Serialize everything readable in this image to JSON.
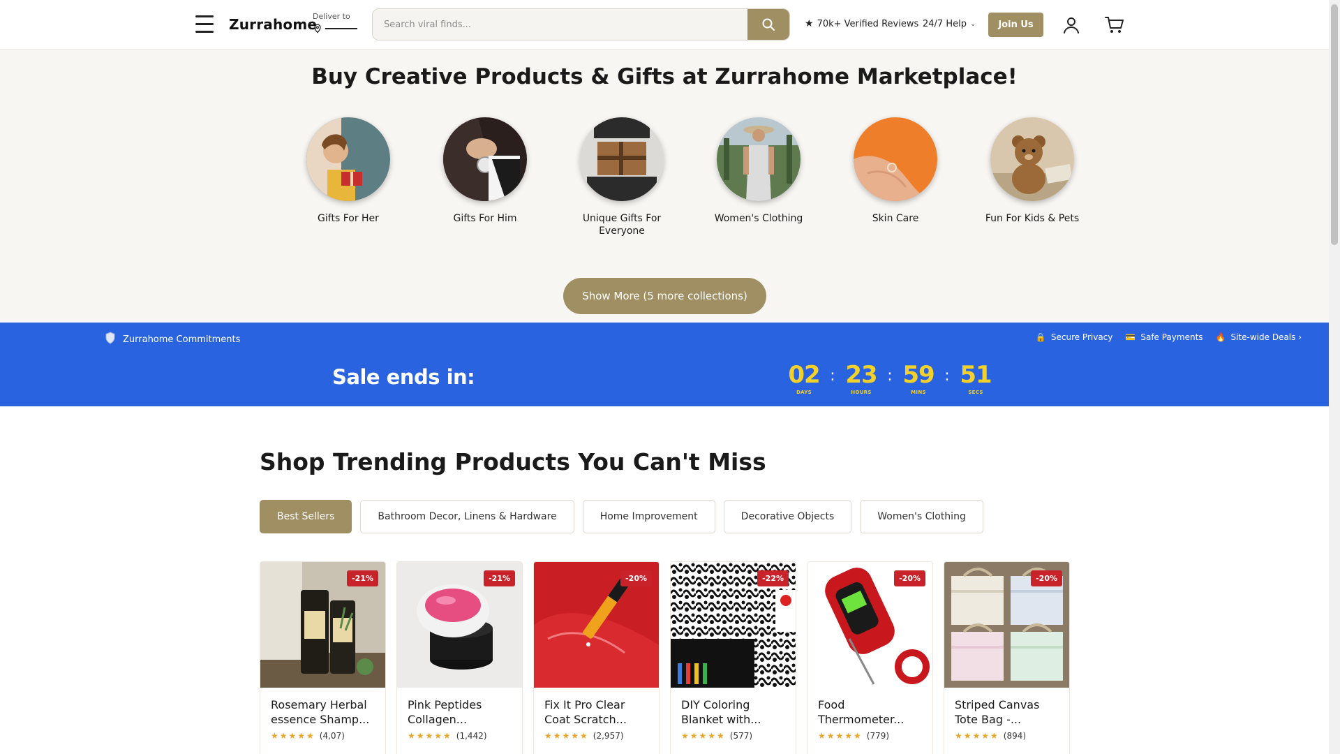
{
  "header": {
    "logo": "Zurrahome",
    "deliver_label": "Deliver to",
    "search_placeholder": "Search viral finds...",
    "reviews": "70k+ Verified Reviews",
    "help": "24/7 Help",
    "join": "Join Us"
  },
  "hero": {
    "title": "Buy Creative Products & Gifts at Zurrahome Marketplace!",
    "collections": [
      {
        "label": "Gifts For Her"
      },
      {
        "label": "Gifts For Him"
      },
      {
        "label": "Unique Gifts For Everyone"
      },
      {
        "label": "Women's Clothing"
      },
      {
        "label": "Skin Care"
      },
      {
        "label": "Fun For Kids & Pets"
      }
    ],
    "show_more": "Show More (5 more collections)"
  },
  "commitments": {
    "label": "Zurrahome Commitments",
    "items": [
      "Secure Privacy",
      "Safe Payments",
      "Site-wide Deals ›"
    ]
  },
  "countdown": {
    "label": "Sale ends in:",
    "days": "02",
    "days_label": "DAYS",
    "hours": "23",
    "hours_label": "HOURS",
    "mins": "59",
    "mins_label": "MINS",
    "secs": "51",
    "secs_label": "SECS"
  },
  "trending": {
    "title": "Shop Trending Products You Can't Miss",
    "tabs": [
      "Best Sellers",
      "Bathroom Decor, Linens & Hardware",
      "Home Improvement",
      "Decorative Objects",
      "Women's Clothing"
    ],
    "products": [
      {
        "name": "Rosemary Herbal essence Shamp...",
        "discount": "-21%",
        "reviews": "(4,07)",
        "stars": "★★★★★"
      },
      {
        "name": "Pink Peptides Collagen...",
        "discount": "-21%",
        "reviews": "(1,442)",
        "stars": "★★★★★"
      },
      {
        "name": "Fix It Pro Clear Coat Scratch...",
        "discount": "-20%",
        "reviews": "(2,957)",
        "stars": "★★★★★"
      },
      {
        "name": "DIY Coloring Blanket with...",
        "discount": "-22%",
        "reviews": "(577)",
        "stars": "★★★★★"
      },
      {
        "name": "Food Thermometer...",
        "discount": "-20%",
        "reviews": "(779)",
        "stars": "★★★★★"
      },
      {
        "name": "Striped Canvas Tote Bag -...",
        "discount": "-20%",
        "reviews": "(894)",
        "stars": "★★★★★"
      }
    ]
  },
  "colors": {
    "accent": "#a08f62",
    "blue_bar": "#2a63e0",
    "timer": "#f3d12b",
    "badge": "#c8222a"
  }
}
